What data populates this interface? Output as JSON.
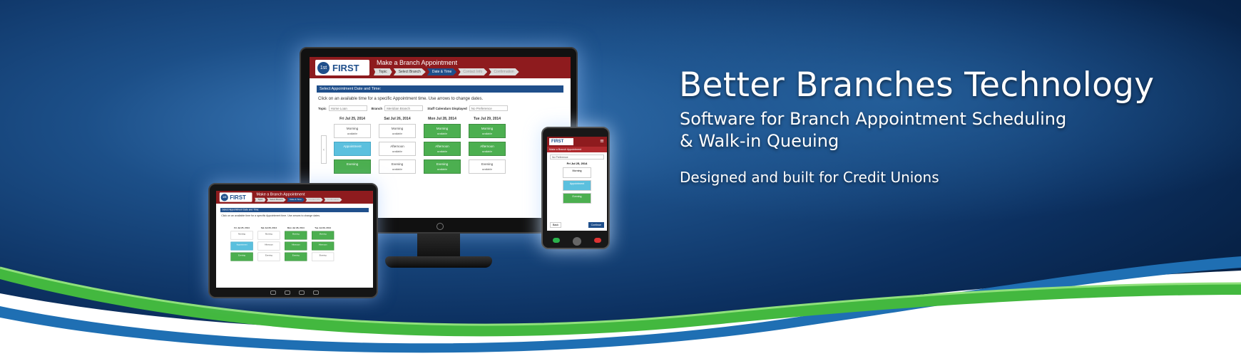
{
  "hero": {
    "headline": "Better Branches Technology",
    "subheadline_line1": "Software for Branch Appointment Scheduling",
    "subheadline_line2": "& Walk-in Queuing",
    "tagline": "Designed and built for Credit Unions"
  },
  "colors": {
    "background_dark": "#0a2a52",
    "background_light": "#2d69a6",
    "swoosh_green": "#4fc24a",
    "swoosh_blue": "#1f6fb3",
    "app_header_red": "#8e1b1e",
    "app_blue": "#1f4f8b",
    "slot_green": "#4caf50",
    "slot_blue": "#5bc0de"
  },
  "app": {
    "logo_badge": "1st",
    "logo_text": "FIRST",
    "title": "Make a Branch Appointment",
    "steps": [
      "Topic",
      "Select Branch",
      "Date & Time",
      "Contact Info",
      "Confirmation"
    ],
    "panel_title": "Select Appointment Date and Time:",
    "instructions": "Click on an available time for a specific Appointment time. Use arrows to change dates.",
    "filters": {
      "topic_label": "Topic",
      "topic_value": "Home Loan",
      "branch_label": "Branch",
      "branch_value": "Meridian Branch",
      "staff_label": "Staff Calendars Displayed",
      "staff_value": "No Preference"
    },
    "available_label": "available",
    "days": [
      {
        "date": "Fri Jul 25, 2014",
        "slots": [
          "Morning",
          "Appointment",
          "Evening"
        ]
      },
      {
        "date": "Sat Jul 26, 2014",
        "slots": [
          "Morning",
          "Afternoon",
          "Evening"
        ]
      },
      {
        "date": "Mon Jul 28, 2014",
        "slots": [
          "Morning",
          "Afternoon",
          "Evening"
        ]
      },
      {
        "date": "Tue Jul 29, 2014",
        "slots": [
          "Morning",
          "Afternoon",
          "Evening"
        ]
      }
    ]
  },
  "phone_app": {
    "logo_text": "FIRST",
    "subtitle": "Make a Branch Appointment",
    "select_value": "No Preference",
    "date": "Fri Jul 25, 2014",
    "slots": [
      "Morning",
      "Appointment",
      "Evening"
    ],
    "back_label": "Back",
    "continue_label": "Continue"
  }
}
